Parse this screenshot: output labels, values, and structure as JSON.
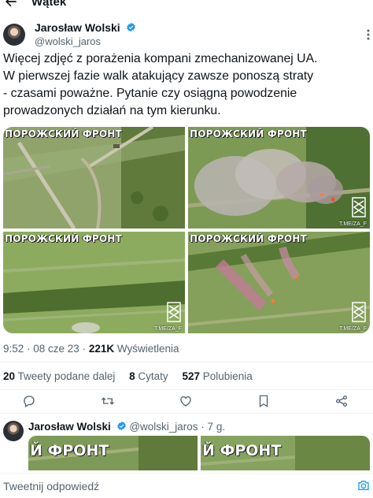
{
  "header": {
    "title": "Wątek"
  },
  "tweet": {
    "author_name": "Jarosław Wolski",
    "author_handle": "@wolski_jaros",
    "text_lines": [
      "Więcej zdjęć z porażenia kompani zmechanizowanej UA.",
      "W pierwszej fazie walk atakujący zawsze ponoszą straty",
      "- czasami poważne. Pytanie czy osiągną powodzenie",
      "prowadzonych działań na tym kierunku."
    ],
    "media": [
      {
        "label": "ПОРОЖСКИЙ ФРОНТ",
        "watermark": ""
      },
      {
        "label": "ПОРОЖСКИЙ ФРОНТ",
        "watermark": "T.ME/ZA_F"
      },
      {
        "label": "ПОРОЖСКИЙ ФРОНТ",
        "watermark": "T.ME/ZA_F"
      },
      {
        "label": "ПОРОЖСКИЙ ФРОНТ",
        "watermark": "T.ME/ZA_F"
      }
    ],
    "time": "9:52 · 08 cze 23 · ",
    "views_count": "221K",
    "views_label": " Wyświetlenia",
    "stats": {
      "retweets_count": "20",
      "retweets_label": " Tweety podane dalej",
      "quotes_count": "8",
      "quotes_label": " Cytaty",
      "likes_count": "527",
      "likes_label": " Polubienia"
    },
    "actions": [
      "reply-icon",
      "retweet-icon",
      "like-icon",
      "bookmark-icon",
      "share-icon"
    ]
  },
  "reply": {
    "author_name": "Jarosław Wolski",
    "author_handle": "@wolski_jaros",
    "age": " · 7 g.",
    "media_labels": [
      "Й ФРОНТ",
      "Й ФРОНТ"
    ]
  },
  "composer": {
    "placeholder": "Tweetnij odpowiedź"
  },
  "colors": {
    "accent": "#1d9bf0",
    "muted": "#536471",
    "text": "#0f1419"
  }
}
